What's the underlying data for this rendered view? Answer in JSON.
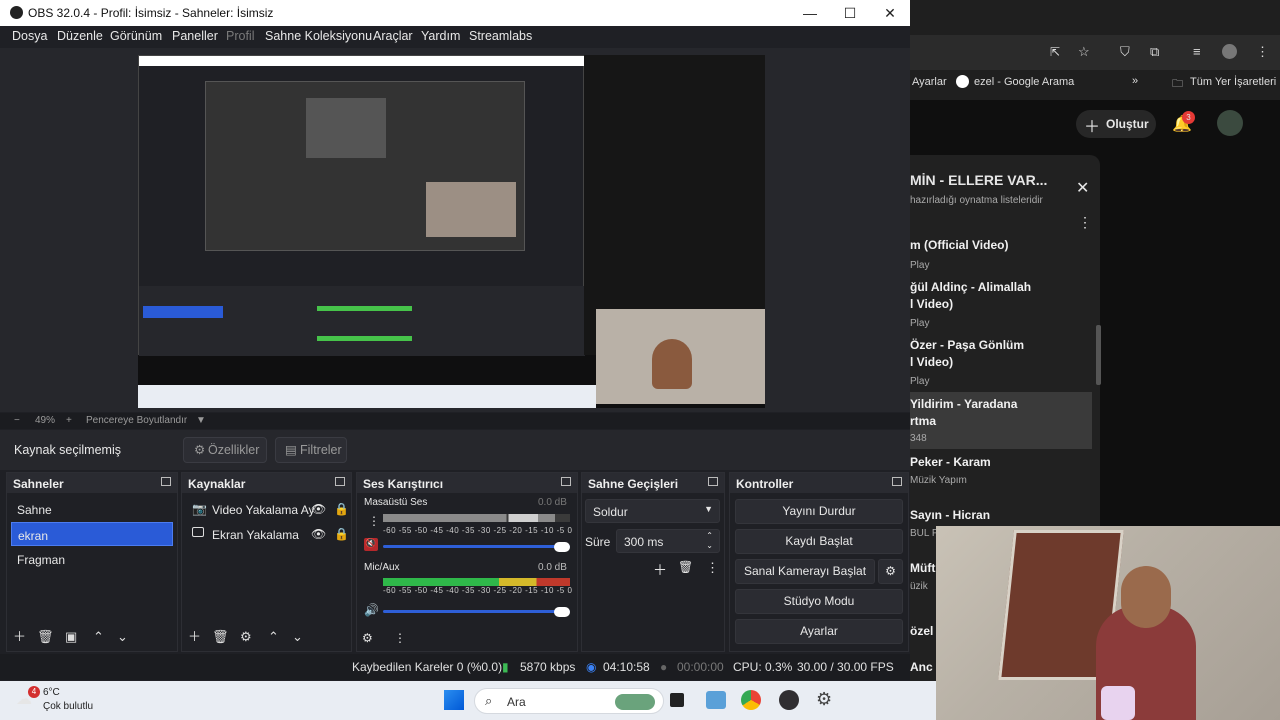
{
  "window": {
    "title": "OBS 32.0.4 - Profil: İsimsiz - Sahneler: İsimsiz",
    "controls": [
      "—",
      "☐",
      "✕"
    ]
  },
  "menu": [
    "Dosya",
    "Düzenle",
    "Görünüm",
    "Paneller",
    "Profil",
    "Sahne Koleksiyonu",
    "Araçlar",
    "Yardım",
    "Streamlabs"
  ],
  "zoom": {
    "minus": "−",
    "value": "49%",
    "plus": "+",
    "fit": "Pencereye Boyutlandır",
    "arrow": "▼"
  },
  "source_bar": {
    "label": "Kaynak seçilmemiş",
    "properties": "Özellikler",
    "filters": "Filtreler"
  },
  "scenes": {
    "title": "Sahneler",
    "items": [
      "Sahne",
      "ekran",
      "Fragman"
    ],
    "selected": "ekran"
  },
  "sources": {
    "title": "Kaynaklar",
    "items": [
      {
        "name": "Video Yakalama Ay",
        "icon": "camera-icon"
      },
      {
        "name": "Ekran Yakalama",
        "icon": "monitor-icon"
      }
    ]
  },
  "mixer": {
    "title": "Ses Karıştırıcı",
    "channels": [
      {
        "name": "Masaüstü Ses",
        "db": "0.0 dB",
        "muted": true,
        "level": 0.55
      },
      {
        "name": "Mic/Aux",
        "db": "0.0 dB",
        "muted": false,
        "level": 1.0
      }
    ],
    "scale": "-60 -55 -50 -45 -40 -35 -30 -25 -20 -15 -10 -5 0"
  },
  "transitions": {
    "title": "Sahne Geçişleri",
    "type": "Soldur",
    "duration_label": "Süre",
    "duration": "300 ms"
  },
  "controls": {
    "title": "Kontroller",
    "buttons": [
      "Yayını Durdur",
      "Kaydı Başlat",
      "Sanal Kamerayı Başlat",
      "Stüdyo Modu",
      "Ayarlar"
    ]
  },
  "status": {
    "dropped": "Kaybedilen Kareler 0 (%0.0)",
    "bitrate": "5870 kbps",
    "stream_time": "04:10:58",
    "rec_time": "00:00:00",
    "cpu": "CPU: 0.3%",
    "fps": "30.00 / 30.00 FPS"
  },
  "browser": {
    "bookmarks": [
      "Ayarlar",
      "ezel - Google Arama",
      "»",
      "Tüm Yer İşaretleri"
    ],
    "create_label": "Oluştur",
    "notif_count": "3",
    "playlist_title": "MİN - ELLERE VAR...",
    "playlist_sub": "hazırladığı oynatma listeleridir",
    "items": [
      {
        "title": "m (Official Video)",
        "sub": "Play"
      },
      {
        "title": "ğül Aldinç - Alimallah",
        "title2": "l Video)",
        "sub": "Play"
      },
      {
        "title": "Özer - Paşa Gönlüm",
        "title2": "l Video)",
        "sub": "Play"
      },
      {
        "title": "Yildirim - Yaradana",
        "title2": "rtma",
        "sub": "348"
      },
      {
        "title": "Peker - Karam",
        "sub": "Müzik Yapım"
      },
      {
        "title": "Sayın - Hicran",
        "sub": "BUL P"
      },
      {
        "title": "Müft",
        "sub": "üzik"
      },
      {
        "title": "özel",
        "sub": ""
      },
      {
        "title": "Anc",
        "sub": ""
      }
    ],
    "colors": {
      "bg": "#0f0f0f",
      "badge": "#e53935"
    }
  },
  "taskbar": {
    "weather_temp": "6°C",
    "weather_desc": "Çok bulutlu",
    "weather_badge": "4",
    "search": "Ara"
  }
}
